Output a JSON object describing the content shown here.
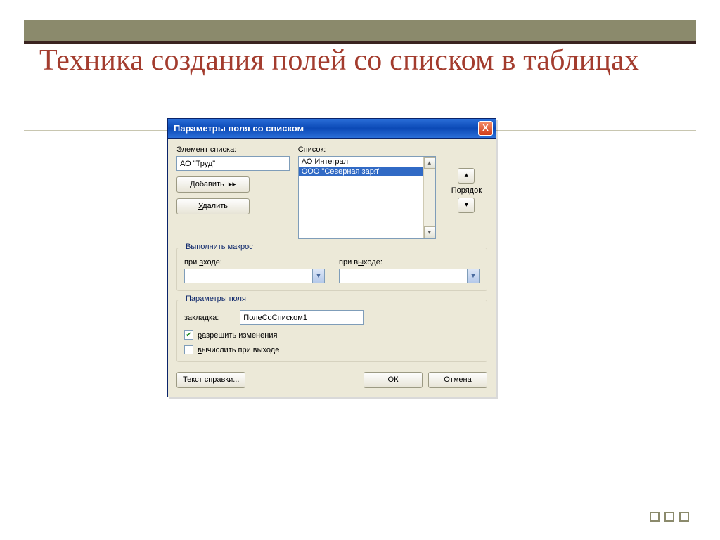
{
  "slide": {
    "title": "Техника создания полей со списком в таблицах"
  },
  "dialog": {
    "title": "Параметры поля со списком",
    "close_icon": "X",
    "labels": {
      "element": "Элемент списка:",
      "list": "Список:",
      "order": "Порядок",
      "macro_group": "Выполнить макрос",
      "on_enter": "при входе:",
      "on_exit": "при выходе:",
      "field_group": "Параметры поля",
      "bookmark": "закладка:"
    },
    "inputs": {
      "element_value": "АО \"Труд\"",
      "bookmark_value": "ПолеСоСписком1",
      "on_enter_value": "",
      "on_exit_value": ""
    },
    "list": {
      "items": [
        "АО Интеграл",
        "ООО \"Северная заря\""
      ],
      "selected_index": 1
    },
    "buttons": {
      "add": "Добавить  ▸▸",
      "delete": "Удалить",
      "up": "▴",
      "down": "▾",
      "help": "Текст справки...",
      "ok": "ОК",
      "cancel": "Отмена"
    },
    "checks": {
      "allow_changes": "разрешить изменения",
      "allow_changes_checked": true,
      "calc_on_exit": "вычислить при выходе",
      "calc_on_exit_checked": false
    },
    "hotkeys": {
      "add": "Д",
      "delete": "У",
      "help": "Т",
      "bookmark": "з",
      "element": "Э",
      "list": "С",
      "on_enter": "в",
      "on_exit": "ы",
      "allow": "р",
      "calc": "в"
    }
  }
}
